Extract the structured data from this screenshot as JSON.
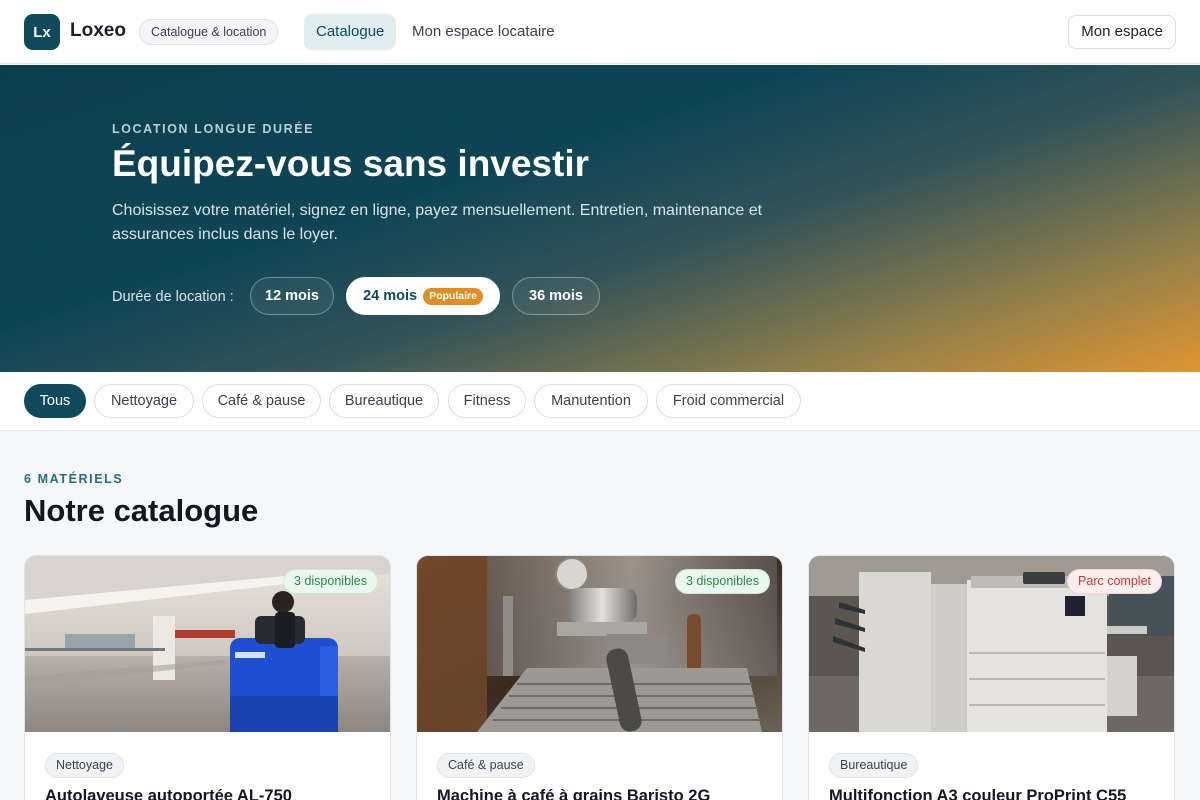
{
  "header": {
    "logo_text": "Lx",
    "brand": "Loxeo",
    "brand_pill": "Catalogue & location",
    "nav": [
      {
        "label": "Catalogue",
        "active": true
      },
      {
        "label": "Mon espace locataire",
        "active": false
      }
    ],
    "account_button": "Mon espace"
  },
  "hero": {
    "eyebrow": "LOCATION LONGUE DURÉE",
    "title": "Équipez-vous sans investir",
    "text": "Choisissez votre matériel, signez en ligne, payez mensuellement. Entretien, maintenance et assurances inclus dans le loyer.",
    "duration_label": "Durée de location :",
    "durations": [
      {
        "label": "12 mois",
        "selected": false
      },
      {
        "label": "24 mois",
        "selected": true,
        "badge": "Populaire"
      },
      {
        "label": "36 mois",
        "selected": false
      }
    ]
  },
  "filters": [
    {
      "label": "Tous",
      "active": true
    },
    {
      "label": "Nettoyage",
      "active": false
    },
    {
      "label": "Café & pause",
      "active": false
    },
    {
      "label": "Bureautique",
      "active": false
    },
    {
      "label": "Fitness",
      "active": false
    },
    {
      "label": "Manutention",
      "active": false
    },
    {
      "label": "Froid commercial",
      "active": false
    }
  ],
  "catalogue": {
    "count": "6 MATÉRIELS",
    "title": "Notre catalogue",
    "items": [
      {
        "category": "Nettoyage",
        "title": "Autolaveuse autoportée AL-750",
        "availability": "3 disponibles",
        "status": "available",
        "image": "floor-scrubber-photo"
      },
      {
        "category": "Café & pause",
        "title": "Machine à café à grains Baristo 2G",
        "availability": "3 disponibles",
        "status": "available",
        "image": "espresso-machine-photo"
      },
      {
        "category": "Bureautique",
        "title": "Multifonction A3 couleur ProPrint C55",
        "availability": "Parc complet",
        "status": "full",
        "image": "copier-photo"
      }
    ]
  },
  "colors": {
    "primary": "#0f4a5c",
    "accent": "#e08e22",
    "available": "#2b8a49",
    "full": "#c93a3a"
  }
}
